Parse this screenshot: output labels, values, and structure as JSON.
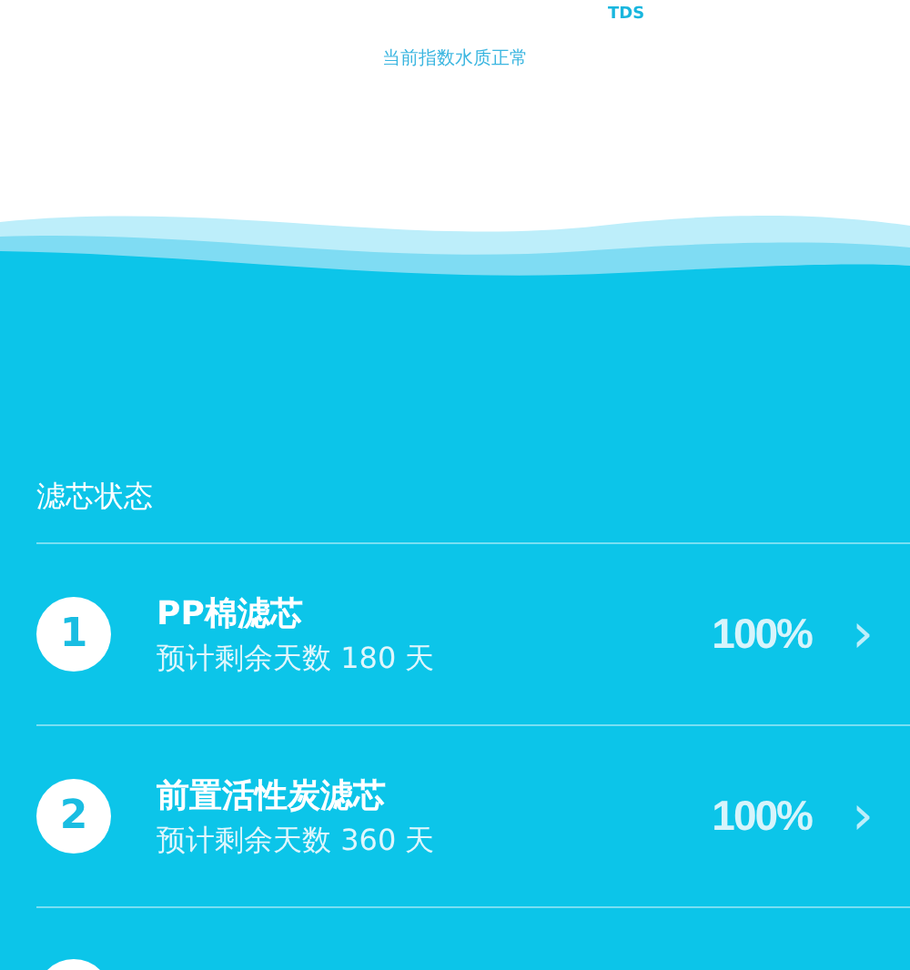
{
  "reading": {
    "unit": "TDS",
    "status": "当前指数水质正常"
  },
  "section_title": "滤芯状态",
  "filters": [
    {
      "kind": "full",
      "number": "1",
      "name": "PP棉滤芯",
      "remaining": "预计剩余天数 180 天",
      "percent": "100%",
      "chevron": "›"
    },
    {
      "kind": "full",
      "number": "2",
      "name": "前置活性炭滤芯",
      "remaining": "预计剩余天数 360 天",
      "percent": "100%",
      "chevron": "›"
    },
    {
      "kind": "cut"
    }
  ]
}
